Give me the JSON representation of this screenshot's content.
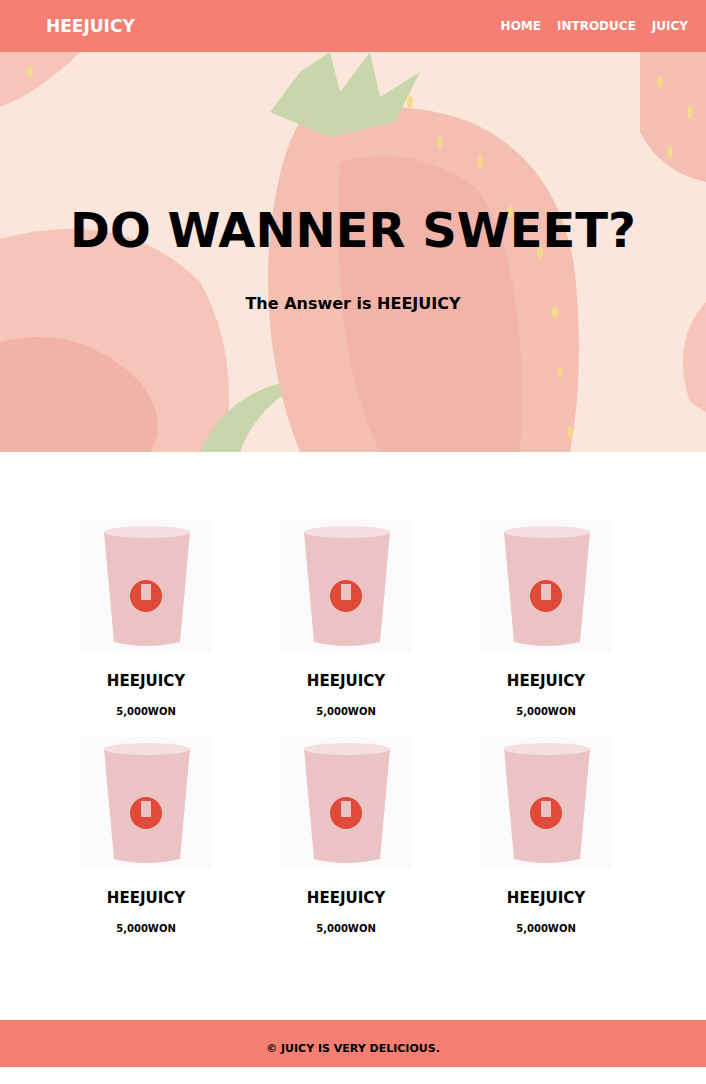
{
  "header": {
    "logo": "HEEJUICY",
    "nav": [
      "HOME",
      "INTRODUCE",
      "JUICY"
    ]
  },
  "hero": {
    "title": "DO WANNER SWEET?",
    "subtitle": "The Answer is HEEJUICY"
  },
  "products": [
    {
      "name": "HEEJUICY",
      "price": "5,000WON"
    },
    {
      "name": "HEEJUICY",
      "price": "5,000WON"
    },
    {
      "name": "HEEJUICY",
      "price": "5,000WON"
    },
    {
      "name": "HEEJUICY",
      "price": "5,000WON"
    },
    {
      "name": "HEEJUICY",
      "price": "5,000WON"
    },
    {
      "name": "HEEJUICY",
      "price": "5,000WON"
    }
  ],
  "footer": {
    "text": "© JUICY IS VERY DELICIOUS."
  }
}
